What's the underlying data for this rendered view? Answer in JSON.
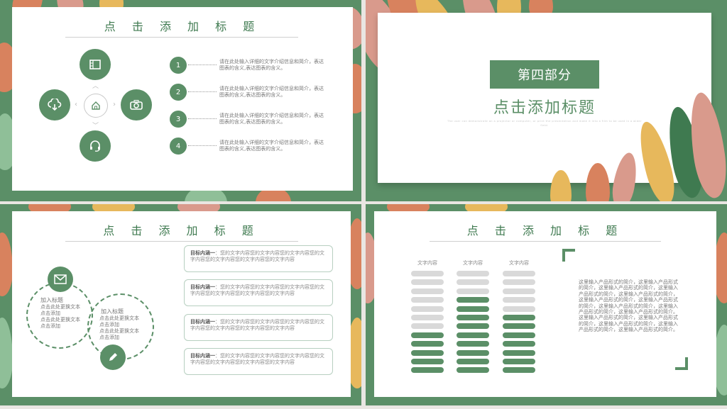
{
  "slide1": {
    "title": "点 击 添 加 标 题",
    "items": [
      {
        "num": "1",
        "text": "请在此处输入详细的文字介绍信息和简介，表达图表的含义,表达图表的含义。"
      },
      {
        "num": "2",
        "text": "请在此处输入详细的文字介绍信息和简介，表达图表的含义,表达图表的含义。"
      },
      {
        "num": "3",
        "text": "请在此处输入详细的文字介绍信息和简介，表达图表的含义,表达图表的含义。"
      },
      {
        "num": "4",
        "text": "请在此处输入详细的文字介绍信息和简介，表达图表的含义,表达图表的含义。"
      }
    ]
  },
  "slide2": {
    "section": "第四部分",
    "title": "点击添加标题",
    "subtitle": "The user can demonstrate on a projector or computer, or print the presentation and make it into a film to be used in a wider field."
  },
  "slide3": {
    "title": "点 击 添 加 标 题",
    "left_label": "加入标题",
    "left_lines": [
      "点击此处更换文本",
      "点击添加",
      "点击此处更换文本",
      "点击添加"
    ],
    "right_label": "加入标题",
    "right_lines": [
      "点击此处更换文本",
      "点击添加",
      "点击此处更换文本",
      "点击添加"
    ],
    "boxes": [
      {
        "label": "目标内涵一",
        "text": "：您的文字内容您的文字内容您的文字内容您的文字内容您的文字内容您的文字内容您的文字内容"
      },
      {
        "label": "目标内涵一",
        "text": "：您的文字内容您的文字内容您的文字内容您的文字内容您的文字内容您的文字内容您的文字内容"
      },
      {
        "label": "目标内涵一",
        "text": "：您的文字内容您的文字内容您的文字内容您的文字内容您的文字内容您的文字内容您的文字内容"
      },
      {
        "label": "目标内涵一",
        "text": "：您的文字内容您的文字内容您的文字内容您的文字内容您的文字内容您的文字内容您的文字内容"
      }
    ]
  },
  "slide4": {
    "title": "点 击 添 加 标 题",
    "columns": [
      {
        "label": "文字内容",
        "filled": 5,
        "total": 12
      },
      {
        "label": "文字内容",
        "filled": 9,
        "total": 12
      },
      {
        "label": "文字内容",
        "filled": 7,
        "total": 12
      }
    ],
    "paragraph": "这里输入产品形式的简介，这里输入产品形式的简介，这里输入产品形式的简介，这里输入产品形式的简介，这里输入产品形式的简介，这里输入产品形式的简介，这里输入产品形式的简介，这里输入产品形式的简介，这里输入产品形式的简介，这里输入产品形式的简介。这里输入产品形式的简介，这里输入产品形式的简介，这里输入产品形式的简介，这里输入产品形式的简介，这里输入产品形式的简介。"
  },
  "colors": {
    "green": "#5b8f67",
    "light_gray": "#d9d9d9",
    "leaf_orange": "#d8825e",
    "leaf_yellow": "#e7b85c",
    "leaf_pink": "#d99a8c"
  }
}
